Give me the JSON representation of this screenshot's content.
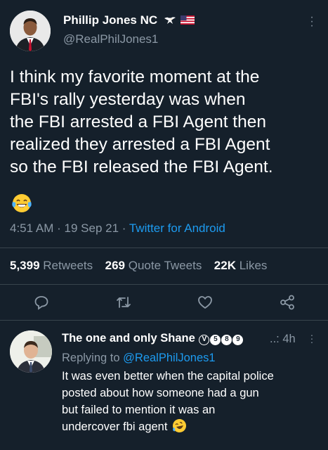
{
  "tweet": {
    "author_name": "Phillip Jones NC",
    "author_name_emoji": [
      "eagle-icon",
      "us-flag-icon"
    ],
    "author_handle": "@RealPhilJones1",
    "text_lines": [
      "I think my favorite moment at the",
      "FBI's rally yesterday was when",
      "the FBI arrested a FBI Agent then",
      "realized they arrested a FBI Agent",
      "so the FBI released the FBI Agent."
    ],
    "text_emoji": "laughing-crying-emoji",
    "time": "4:51 AM",
    "sep1": "·",
    "date": "19 Sep 21",
    "sep2": "·",
    "client": "Twitter for Android"
  },
  "stats": {
    "retweets_count": "5,399",
    "retweets_label": "Retweets",
    "quotes_count": "269",
    "quotes_label": "Quote Tweets",
    "likes_count": "22K",
    "likes_label": "Likes"
  },
  "actions": [
    "reply-icon",
    "retweet-icon",
    "like-icon",
    "share-icon"
  ],
  "reply": {
    "author_name": "The one and only Shane",
    "badges": {
      "v": "V",
      "b1": "5",
      "b2": "8",
      "b3": "9"
    },
    "trailing_dots": "..:",
    "time": "4h",
    "replying_prefix": "Replying to",
    "replying_to": "@RealPhilJones1",
    "text_lines": [
      "It was even better when the capital police",
      "posted about how someone had a gun",
      "but failed to mention it was an",
      "undercover fbi agent"
    ],
    "text_emoji": "rofl-emoji"
  },
  "colors": {
    "background": "#15202b",
    "text": "#ffffff",
    "secondary": "#8b98a5",
    "link": "#1d9bf0",
    "divider": "#38444d"
  }
}
